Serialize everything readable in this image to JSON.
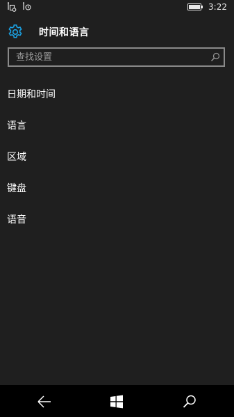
{
  "status_bar": {
    "time": "3:22",
    "battery_level": 0.9,
    "left_icons": [
      "notification-app-icon",
      "notification-alarm-icon"
    ]
  },
  "header": {
    "title": "时间和语言",
    "icon": "gear-icon",
    "accent_color": "#1ba1e2"
  },
  "search": {
    "placeholder": "查找设置",
    "value": ""
  },
  "menu": {
    "items": [
      {
        "label": "日期和时间"
      },
      {
        "label": "语言"
      },
      {
        "label": "区域"
      },
      {
        "label": "键盘"
      },
      {
        "label": "语音"
      }
    ]
  },
  "nav_bar": {
    "buttons": [
      "back-icon",
      "windows-start-icon",
      "search-icon"
    ]
  }
}
